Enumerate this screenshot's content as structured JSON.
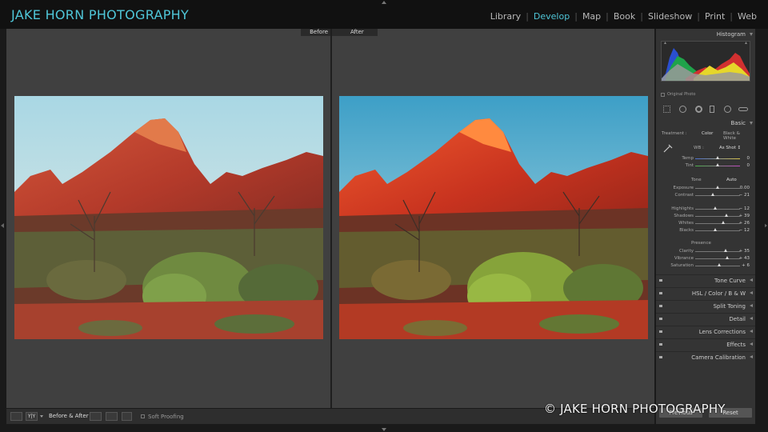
{
  "app": {
    "brand": "JAKE HORN PHOTOGRAPHY",
    "accent_color": "#4fc6d8"
  },
  "modules": [
    {
      "label": "Library",
      "active": false
    },
    {
      "label": "Develop",
      "active": true
    },
    {
      "label": "Map",
      "active": false
    },
    {
      "label": "Book",
      "active": false
    },
    {
      "label": "Slideshow",
      "active": false
    },
    {
      "label": "Print",
      "active": false
    },
    {
      "label": "Web",
      "active": false
    }
  ],
  "view": {
    "before_label": "Before",
    "after_label": "After"
  },
  "toolbar": {
    "yy_label": "Y|Y",
    "before_after_label": "Before & After :",
    "soft_proofing_label": "Soft Proofing"
  },
  "histogram": {
    "title": "Histogram",
    "original_photo_label": "Original Photo"
  },
  "basic": {
    "title": "Basic",
    "treatment_label": "Treatment :",
    "treatment_color": "Color",
    "treatment_bw": "Black & White",
    "wb_label": "WB :",
    "wb_value": "As Shot ↕",
    "tone_label": "Tone",
    "auto_label": "Auto",
    "presence_label": "Presence",
    "sliders_wb": [
      {
        "label": "Temp",
        "value": "0",
        "pos": 0.5
      },
      {
        "label": "Tint",
        "value": "0",
        "pos": 0.5
      }
    ],
    "sliders_tone": [
      {
        "label": "Exposure",
        "value": "0.00",
        "pos": 0.5
      },
      {
        "label": "Contrast",
        "value": "− 21",
        "pos": 0.4
      },
      {
        "label": "Highlights",
        "value": "− 12",
        "pos": 0.44
      },
      {
        "label": "Shadows",
        "value": "+ 39",
        "pos": 0.7
      },
      {
        "label": "Whites",
        "value": "+ 26",
        "pos": 0.63
      },
      {
        "label": "Blacks",
        "value": "− 12",
        "pos": 0.44
      }
    ],
    "sliders_presence": [
      {
        "label": "Clarity",
        "value": "+ 35",
        "pos": 0.68
      },
      {
        "label": "Vibrance",
        "value": "+ 43",
        "pos": 0.72
      },
      {
        "label": "Saturation",
        "value": "+ 6",
        "pos": 0.53
      }
    ]
  },
  "panels": [
    {
      "label": "Tone Curve"
    },
    {
      "label": "HSL / Color / B & W"
    },
    {
      "label": "Split Toning"
    },
    {
      "label": "Detail"
    },
    {
      "label": "Lens Corrections"
    },
    {
      "label": "Effects"
    },
    {
      "label": "Camera Calibration"
    }
  ],
  "buttons": {
    "previous": "Previous",
    "reset": "Reset"
  },
  "watermark": "© JAKE HORN PHOTOGRAPHY"
}
